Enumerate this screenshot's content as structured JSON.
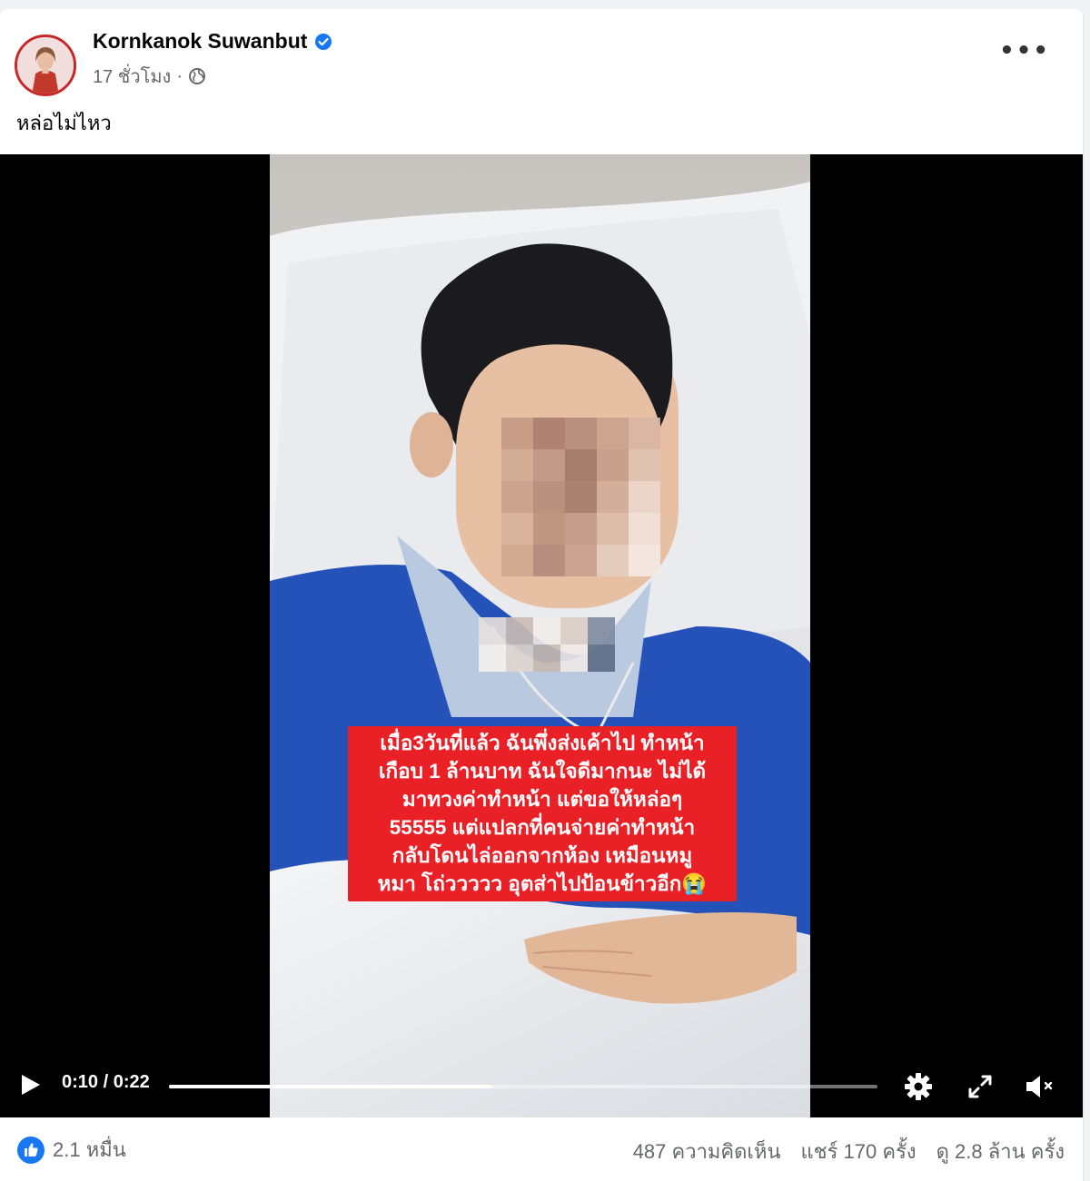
{
  "post": {
    "author": "Kornkanok Suwanbut",
    "timestamp": "17 ชั่วโมง",
    "separator": "·",
    "text": "หล่อไม่ไหว"
  },
  "video": {
    "caption_lines": [
      "เมื่อ3วันที่แล้ว ฉันพึ่งส่งเค้าไป ทำหน้า",
      "เกือบ 1 ล้านบาท ฉันใจดีมากนะ ไม่ได้",
      "มาทวงค่าทำหน้า แต่ขอให้หล่อๆ",
      "55555 แต่แปลกที่คนจ่ายค่าทำหน้า",
      "กลับโดนไล่ออกจากห้อง เหมือนหมู",
      "หมา โถ่ววววว อุตส่าไปป้อนข้าวอีก😭"
    ],
    "time_display": "0:10 / 0:22",
    "progress_fraction": 0.455
  },
  "engagement": {
    "reactions": "2.1 หมื่น",
    "comments": "487 ความคิดเห็น",
    "shares": "แชร์ 170 ครั้ง",
    "views": "ดู 2.8 ล้าน ครั้ง"
  },
  "colors": {
    "caption_bg": "#ea2027",
    "verified": "#1877f2",
    "like": "#1877f2"
  },
  "icons": [
    "verified-badge-icon",
    "globe-icon",
    "more-options-icon",
    "play-icon",
    "settings-gear-icon",
    "fullscreen-icon",
    "volume-muted-icon",
    "like-reaction-icon"
  ]
}
